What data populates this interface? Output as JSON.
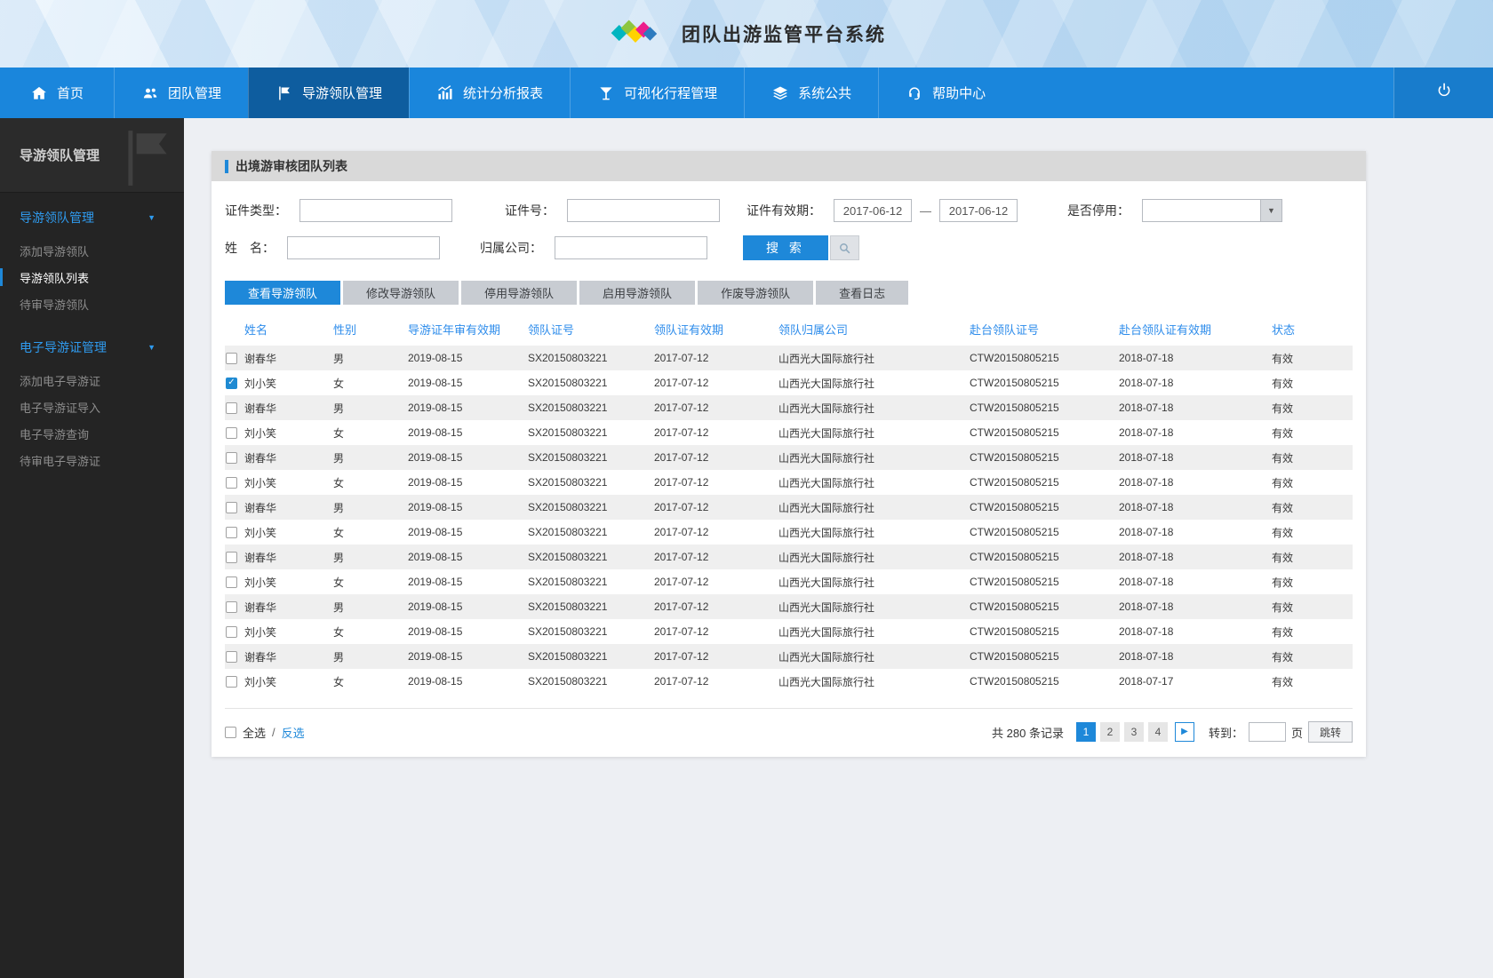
{
  "header": {
    "title": "团队出游监管平台系统"
  },
  "nav": {
    "items": [
      {
        "label": "首页",
        "icon": "home-icon",
        "active": false
      },
      {
        "label": "团队管理",
        "icon": "team-icon",
        "active": false
      },
      {
        "label": "导游领队管理",
        "icon": "flag-icon",
        "active": true
      },
      {
        "label": "统计分析报表",
        "icon": "chart-icon",
        "active": false
      },
      {
        "label": "可视化行程管理",
        "icon": "itinerary-icon",
        "active": false
      },
      {
        "label": "系统公共",
        "icon": "layers-icon",
        "active": false
      },
      {
        "label": "帮助中心",
        "icon": "headset-icon",
        "active": false
      }
    ],
    "logout_icon": "power-icon"
  },
  "sidebar": {
    "title": "导游领队管理",
    "sections": [
      {
        "label": "导游领队管理",
        "expanded": true,
        "items": [
          {
            "label": "添加导游领队",
            "active": false
          },
          {
            "label": "导游领队列表",
            "active": true
          },
          {
            "label": "待审导游领队",
            "active": false
          }
        ]
      },
      {
        "label": "电子导游证管理",
        "expanded": true,
        "items": [
          {
            "label": "添加电子导游证",
            "active": false
          },
          {
            "label": "电子导游证导入",
            "active": false
          },
          {
            "label": "电子导游查询",
            "active": false
          },
          {
            "label": "待审电子导游证",
            "active": false
          }
        ]
      }
    ]
  },
  "panel": {
    "title": "出境游审核团队列表"
  },
  "search": {
    "cert_type_label": "证件类型：",
    "cert_no_label": "证件号：",
    "cert_valid_label": "证件有效期：",
    "date_from": "2017-06-12",
    "date_to": "2017-06-12",
    "date_separator": "—",
    "disabled_label": "是否停用：",
    "name_label": "姓　名：",
    "company_label": "归属公司：",
    "search_button": "搜 索"
  },
  "tabs": [
    {
      "label": "查看导游领队",
      "active": true
    },
    {
      "label": "修改导游领队",
      "active": false
    },
    {
      "label": "停用导游领队",
      "active": false
    },
    {
      "label": "启用导游领队",
      "active": false
    },
    {
      "label": "作废导游领队",
      "active": false
    },
    {
      "label": "查看日志",
      "active": false
    }
  ],
  "table": {
    "columns": [
      "姓名",
      "性别",
      "导游证年审有效期",
      "领队证号",
      "领队证有效期",
      "领队归属公司",
      "赴台领队证号",
      "赴台领队证有效期",
      "状态"
    ],
    "rows": [
      {
        "checked": false,
        "name": "谢春华",
        "gender": "男",
        "guide_cert_valid": "2019-08-15",
        "leader_cert_no": "SX20150803221",
        "leader_cert_valid": "2017-07-12",
        "company": "山西光大国际旅行社",
        "taiwan_cert_no": "CTW20150805215",
        "taiwan_cert_valid": "2018-07-18",
        "status": "有效"
      },
      {
        "checked": true,
        "name": "刘小笑",
        "gender": "女",
        "guide_cert_valid": "2019-08-15",
        "leader_cert_no": "SX20150803221",
        "leader_cert_valid": "2017-07-12",
        "company": "山西光大国际旅行社",
        "taiwan_cert_no": "CTW20150805215",
        "taiwan_cert_valid": "2018-07-18",
        "status": "有效"
      },
      {
        "checked": false,
        "name": "谢春华",
        "gender": "男",
        "guide_cert_valid": "2019-08-15",
        "leader_cert_no": "SX20150803221",
        "leader_cert_valid": "2017-07-12",
        "company": "山西光大国际旅行社",
        "taiwan_cert_no": "CTW20150805215",
        "taiwan_cert_valid": "2018-07-18",
        "status": "有效"
      },
      {
        "checked": false,
        "name": "刘小笑",
        "gender": "女",
        "guide_cert_valid": "2019-08-15",
        "leader_cert_no": "SX20150803221",
        "leader_cert_valid": "2017-07-12",
        "company": "山西光大国际旅行社",
        "taiwan_cert_no": "CTW20150805215",
        "taiwan_cert_valid": "2018-07-18",
        "status": "有效"
      },
      {
        "checked": false,
        "name": "谢春华",
        "gender": "男",
        "guide_cert_valid": "2019-08-15",
        "leader_cert_no": "SX20150803221",
        "leader_cert_valid": "2017-07-12",
        "company": "山西光大国际旅行社",
        "taiwan_cert_no": "CTW20150805215",
        "taiwan_cert_valid": "2018-07-18",
        "status": "有效"
      },
      {
        "checked": false,
        "name": "刘小笑",
        "gender": "女",
        "guide_cert_valid": "2019-08-15",
        "leader_cert_no": "SX20150803221",
        "leader_cert_valid": "2017-07-12",
        "company": "山西光大国际旅行社",
        "taiwan_cert_no": "CTW20150805215",
        "taiwan_cert_valid": "2018-07-18",
        "status": "有效"
      },
      {
        "checked": false,
        "name": "谢春华",
        "gender": "男",
        "guide_cert_valid": "2019-08-15",
        "leader_cert_no": "SX20150803221",
        "leader_cert_valid": "2017-07-12",
        "company": "山西光大国际旅行社",
        "taiwan_cert_no": "CTW20150805215",
        "taiwan_cert_valid": "2018-07-18",
        "status": "有效"
      },
      {
        "checked": false,
        "name": "刘小笑",
        "gender": "女",
        "guide_cert_valid": "2019-08-15",
        "leader_cert_no": "SX20150803221",
        "leader_cert_valid": "2017-07-12",
        "company": "山西光大国际旅行社",
        "taiwan_cert_no": "CTW20150805215",
        "taiwan_cert_valid": "2018-07-18",
        "status": "有效"
      },
      {
        "checked": false,
        "name": "谢春华",
        "gender": "男",
        "guide_cert_valid": "2019-08-15",
        "leader_cert_no": "SX20150803221",
        "leader_cert_valid": "2017-07-12",
        "company": "山西光大国际旅行社",
        "taiwan_cert_no": "CTW20150805215",
        "taiwan_cert_valid": "2018-07-18",
        "status": "有效"
      },
      {
        "checked": false,
        "name": "刘小笑",
        "gender": "女",
        "guide_cert_valid": "2019-08-15",
        "leader_cert_no": "SX20150803221",
        "leader_cert_valid": "2017-07-12",
        "company": "山西光大国际旅行社",
        "taiwan_cert_no": "CTW20150805215",
        "taiwan_cert_valid": "2018-07-18",
        "status": "有效"
      },
      {
        "checked": false,
        "name": "谢春华",
        "gender": "男",
        "guide_cert_valid": "2019-08-15",
        "leader_cert_no": "SX20150803221",
        "leader_cert_valid": "2017-07-12",
        "company": "山西光大国际旅行社",
        "taiwan_cert_no": "CTW20150805215",
        "taiwan_cert_valid": "2018-07-18",
        "status": "有效"
      },
      {
        "checked": false,
        "name": "刘小笑",
        "gender": "女",
        "guide_cert_valid": "2019-08-15",
        "leader_cert_no": "SX20150803221",
        "leader_cert_valid": "2017-07-12",
        "company": "山西光大国际旅行社",
        "taiwan_cert_no": "CTW20150805215",
        "taiwan_cert_valid": "2018-07-18",
        "status": "有效"
      },
      {
        "checked": false,
        "name": "谢春华",
        "gender": "男",
        "guide_cert_valid": "2019-08-15",
        "leader_cert_no": "SX20150803221",
        "leader_cert_valid": "2017-07-12",
        "company": "山西光大国际旅行社",
        "taiwan_cert_no": "CTW20150805215",
        "taiwan_cert_valid": "2018-07-18",
        "status": "有效"
      },
      {
        "checked": false,
        "name": "刘小笑",
        "gender": "女",
        "guide_cert_valid": "2019-08-15",
        "leader_cert_no": "SX20150803221",
        "leader_cert_valid": "2017-07-12",
        "company": "山西光大国际旅行社",
        "taiwan_cert_no": "CTW20150805215",
        "taiwan_cert_valid": "2018-07-17",
        "status": "有效"
      }
    ]
  },
  "footer": {
    "select_all_label": "全选",
    "divider": "/",
    "invert_label": "反选",
    "record_count": "共 280 条记录",
    "pages": [
      "1",
      "2",
      "3",
      "4"
    ],
    "active_page": "1",
    "goto_label": "转到：",
    "page_unit_label": "页",
    "goto_button_label": "跳转"
  },
  "colors": {
    "accent_blue": "#1e88d9",
    "nav_blue": "#1a86dc",
    "nav_active": "#0e5d9f",
    "sidebar_bg": "#242424",
    "header_link_blue": "#2d8ceb",
    "row_alt": "#efefef"
  }
}
